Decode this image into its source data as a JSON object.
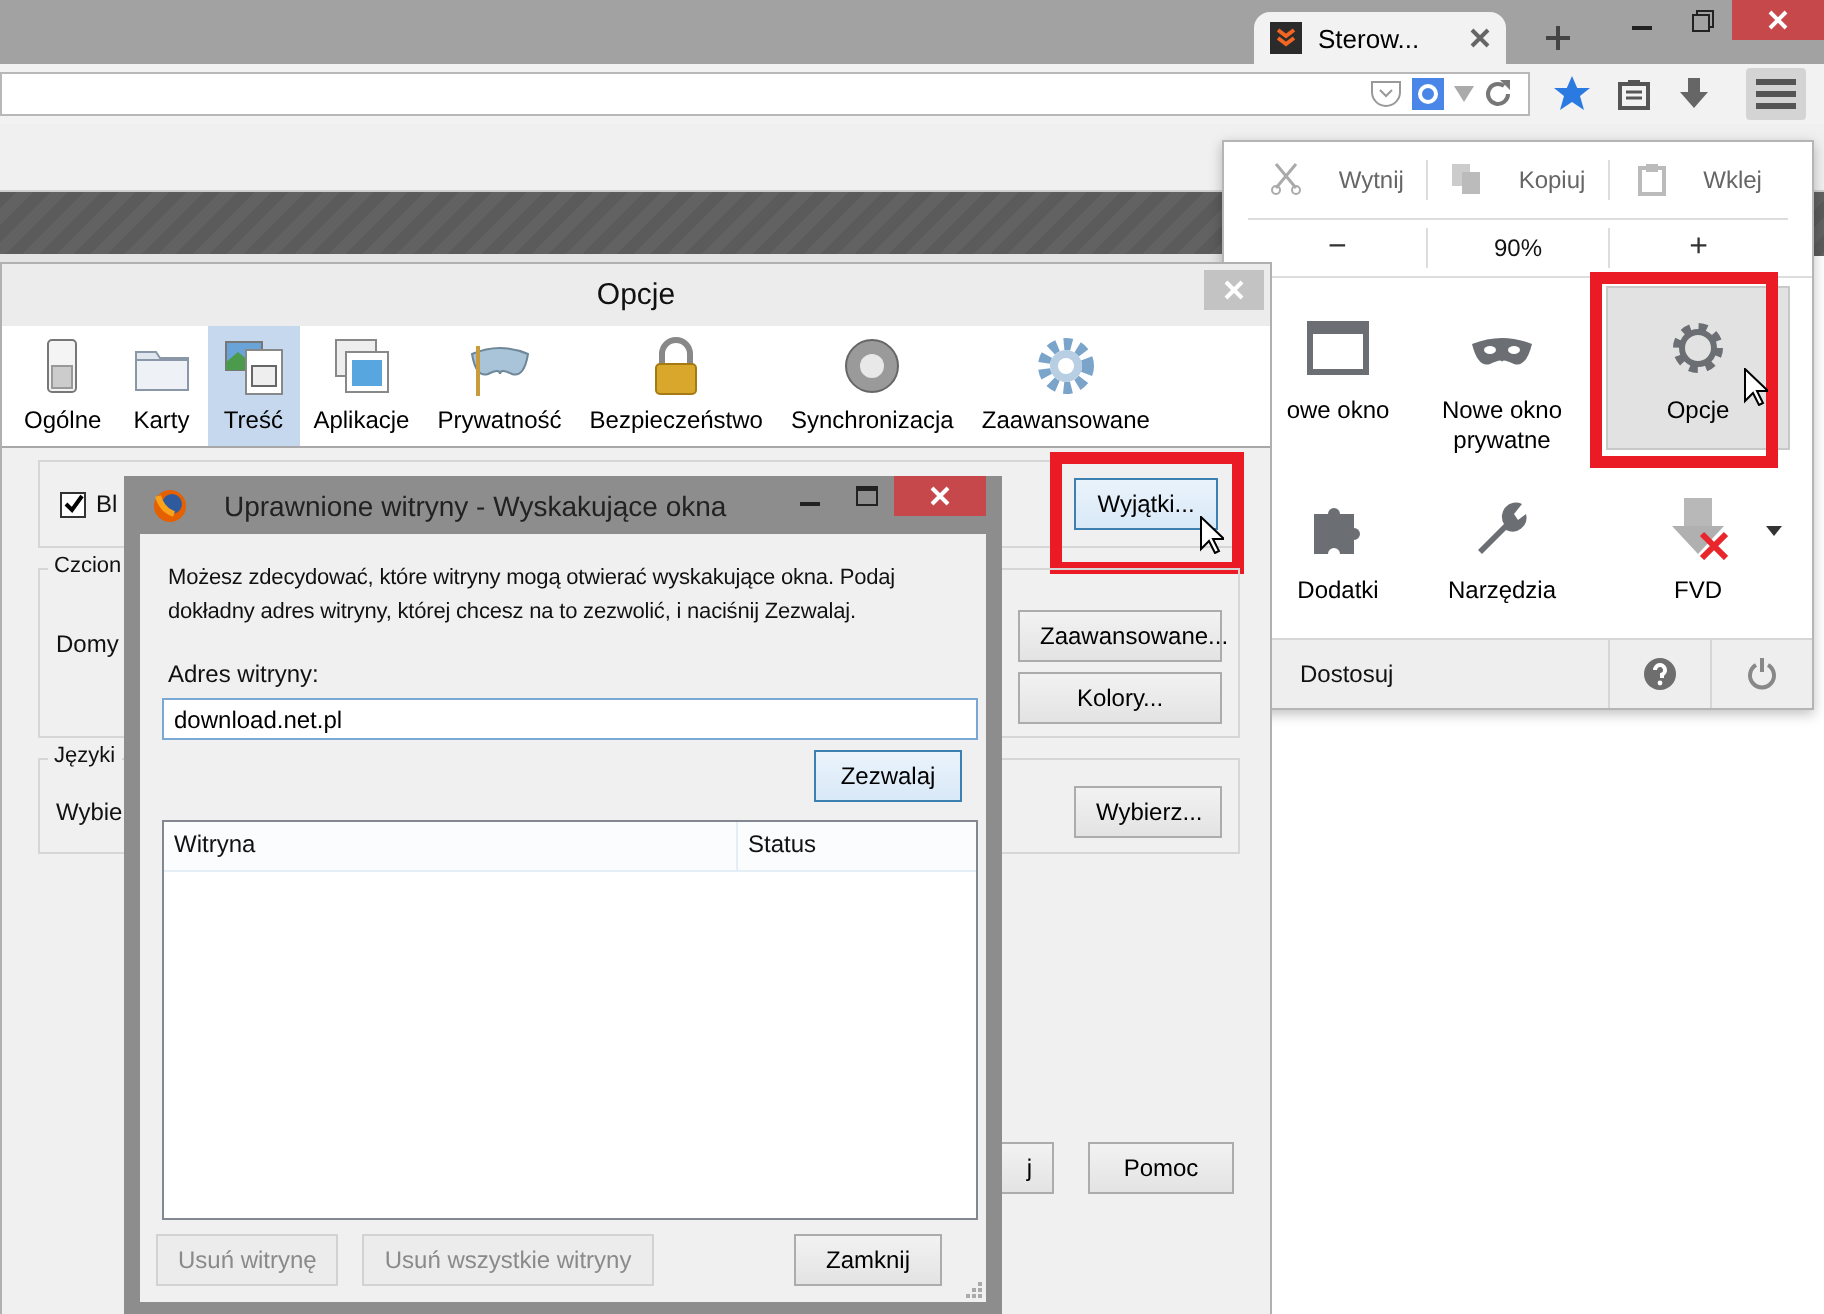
{
  "browser": {
    "tabs": [
      {
        "title": "Sterow...",
        "selected": true
      }
    ]
  },
  "menu_panel": {
    "edit_items": [
      {
        "label": "Wytnij",
        "disabled": true
      },
      {
        "label": "Kopiuj",
        "disabled": true
      },
      {
        "label": "Wklej",
        "disabled": true
      }
    ],
    "zoom": {
      "minus": "−",
      "value": "90%",
      "plus": "+"
    },
    "items": [
      {
        "label": "owe okno",
        "selected": false,
        "highlighted": false
      },
      {
        "label": "Nowe okno prywatne",
        "selected": false,
        "highlighted": false
      },
      {
        "label": "Opcje",
        "selected": true,
        "highlighted": true
      },
      {
        "label": "Dodatki",
        "selected": false,
        "highlighted": false
      },
      {
        "label": "Narzędzia",
        "selected": false,
        "highlighted": false
      },
      {
        "label": "FVD",
        "selected": false,
        "highlighted": false,
        "dropdown": true
      }
    ],
    "footer": {
      "label": "Dostosuj"
    }
  },
  "options_window": {
    "title": "Opcje",
    "tabs": [
      {
        "label": "Ogólne",
        "selected": false
      },
      {
        "label": "Karty",
        "selected": false
      },
      {
        "label": "Treść",
        "selected": true
      },
      {
        "label": "Aplikacje",
        "selected": false
      },
      {
        "label": "Prywatność",
        "selected": false
      },
      {
        "label": "Bezpieczeństwo",
        "selected": false
      },
      {
        "label": "Synchronizacja",
        "selected": false
      },
      {
        "label": "Zaawansowane",
        "selected": false
      }
    ],
    "popup_checkbox": {
      "label": "Bl",
      "checked": true
    },
    "exceptions_button": {
      "label": "Wyjątki...",
      "highlighted": true
    },
    "fonts_group": {
      "title": "Czcion",
      "label": "Domy",
      "buttons": [
        "Zaawansowane...",
        "Kolory..."
      ]
    },
    "languages_group": {
      "title": "Języki",
      "label": "Wybie",
      "button": "Wybierz..."
    },
    "bottom_buttons": [
      "j",
      "Pomoc"
    ]
  },
  "dialog": {
    "title": "Uprawnione witryny - Wyskakujące okna",
    "description": "Możesz zdecydować, które witryny mogą otwierać wyskakujące okna. Podaj dokładny adres witryny, której chcesz na to zezwolić, i naciśnij Zezwalaj.",
    "address_label": "Adres witryny:",
    "address_value": "download.net.pl",
    "allow_button": "Zezwalaj",
    "columns": [
      "Witryna",
      "Status"
    ],
    "buttons": [
      {
        "label": "Usuń witrynę",
        "disabled": true
      },
      {
        "label": "Usuń wszystkie witryny",
        "disabled": true
      },
      {
        "label": "Zamknij",
        "disabled": false
      }
    ]
  }
}
